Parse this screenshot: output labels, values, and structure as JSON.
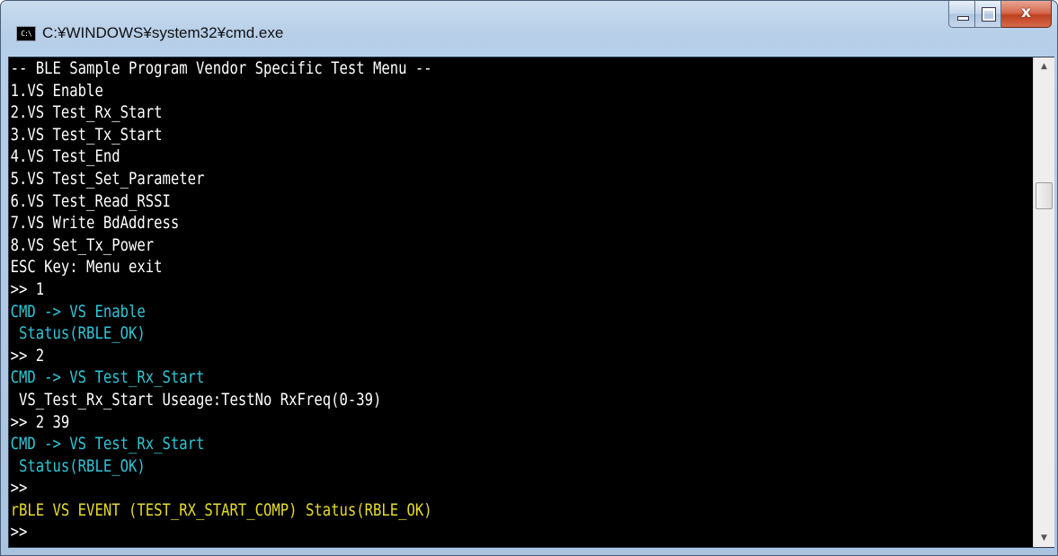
{
  "window": {
    "title": "C:¥WINDOWS¥system32¥cmd.exe",
    "icon_text": "C:\\",
    "minimize_icon": "minimize-icon",
    "maximize_icon": "maximize-icon",
    "close_icon": "close-icon",
    "close_glyph": "x"
  },
  "colors": {
    "white": "#ffffff",
    "cyan": "#2ec7d8",
    "yellow": "#e6dc2a",
    "background": "#000000"
  },
  "console": {
    "lines": [
      {
        "text": "-- BLE Sample Program Vendor Specific Test Menu --",
        "color": "white"
      },
      {
        "text": "1.VS Enable",
        "color": "white"
      },
      {
        "text": "2.VS Test_Rx_Start",
        "color": "white"
      },
      {
        "text": "3.VS Test_Tx_Start",
        "color": "white"
      },
      {
        "text": "4.VS Test_End",
        "color": "white"
      },
      {
        "text": "5.VS Test_Set_Parameter",
        "color": "white"
      },
      {
        "text": "6.VS Test_Read_RSSI",
        "color": "white"
      },
      {
        "text": "7.VS Write BdAddress",
        "color": "white"
      },
      {
        "text": "8.VS Set_Tx_Power",
        "color": "white"
      },
      {
        "text": "ESC Key: Menu exit",
        "color": "white"
      },
      {
        "text": ">> 1",
        "color": "white",
        "input": "1"
      },
      {
        "text": "CMD -> VS Enable",
        "color": "cyan"
      },
      {
        "text": " Status(RBLE_OK)",
        "color": "cyan"
      },
      {
        "text": ">> 2",
        "color": "white",
        "input": "2"
      },
      {
        "text": "CMD -> VS Test_Rx_Start",
        "color": "cyan"
      },
      {
        "text": " VS_Test_Rx_Start Useage:TestNo RxFreq(0-39)",
        "color": "white"
      },
      {
        "text": ">> 2 39",
        "color": "white",
        "input": "2 39"
      },
      {
        "text": "CMD -> VS Test_Rx_Start",
        "color": "cyan"
      },
      {
        "text": " Status(RBLE_OK)",
        "color": "cyan"
      },
      {
        "text": ">>",
        "color": "white"
      },
      {
        "text": "rBLE VS EVENT (TEST_RX_START_COMP) Status(RBLE_OK)",
        "color": "yellow"
      },
      {
        "text": ">>",
        "color": "white"
      }
    ]
  },
  "scrollbar": {
    "up_icon": "scroll-up-arrow-icon",
    "down_icon": "scroll-down-arrow-icon",
    "up_glyph": "▲",
    "down_glyph": "▼",
    "position_fraction": 0.25
  }
}
